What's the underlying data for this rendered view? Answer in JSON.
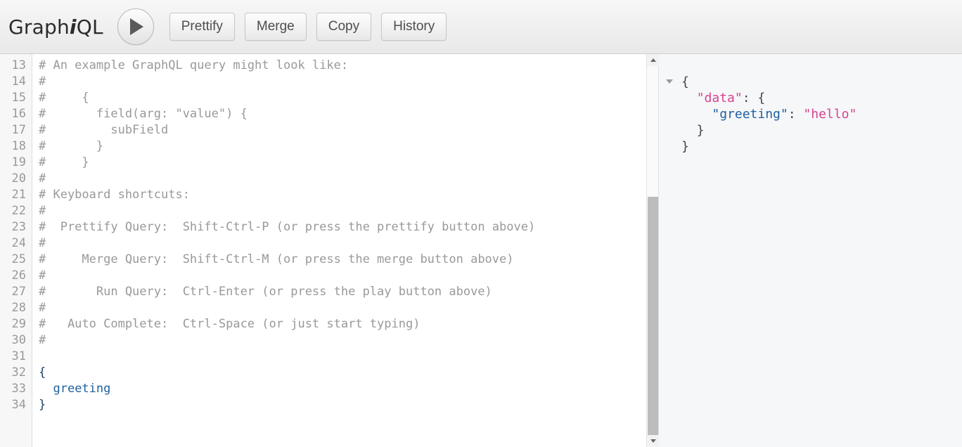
{
  "app": {
    "logo_prefix": "Graph",
    "logo_italic": "i",
    "logo_suffix": "QL"
  },
  "toolbar": {
    "execute_label": "play-icon",
    "prettify_label": "Prettify",
    "merge_label": "Merge",
    "copy_label": "Copy",
    "history_label": "History"
  },
  "editor": {
    "first_line_number": 13,
    "lines": [
      {
        "n": "13",
        "text": "# An example GraphQL query might look like:",
        "kind": "comment"
      },
      {
        "n": "14",
        "text": "#",
        "kind": "comment"
      },
      {
        "n": "15",
        "text": "#     {",
        "kind": "comment"
      },
      {
        "n": "16",
        "text": "#       field(arg: \"value\") {",
        "kind": "comment"
      },
      {
        "n": "17",
        "text": "#         subField",
        "kind": "comment"
      },
      {
        "n": "18",
        "text": "#       }",
        "kind": "comment"
      },
      {
        "n": "19",
        "text": "#     }",
        "kind": "comment"
      },
      {
        "n": "20",
        "text": "#",
        "kind": "comment"
      },
      {
        "n": "21",
        "text": "# Keyboard shortcuts:",
        "kind": "comment"
      },
      {
        "n": "22",
        "text": "#",
        "kind": "comment"
      },
      {
        "n": "23",
        "text": "#  Prettify Query:  Shift-Ctrl-P (or press the prettify button above)",
        "kind": "comment"
      },
      {
        "n": "24",
        "text": "#",
        "kind": "comment"
      },
      {
        "n": "25",
        "text": "#     Merge Query:  Shift-Ctrl-M (or press the merge button above)",
        "kind": "comment"
      },
      {
        "n": "26",
        "text": "#",
        "kind": "comment"
      },
      {
        "n": "27",
        "text": "#       Run Query:  Ctrl-Enter (or press the play button above)",
        "kind": "comment"
      },
      {
        "n": "28",
        "text": "#",
        "kind": "comment"
      },
      {
        "n": "29",
        "text": "#   Auto Complete:  Ctrl-Space (or just start typing)",
        "kind": "comment"
      },
      {
        "n": "30",
        "text": "#",
        "kind": "comment"
      },
      {
        "n": "31",
        "text": "",
        "kind": "blank"
      },
      {
        "n": "32",
        "text": "{",
        "kind": "query"
      },
      {
        "n": "33",
        "text": "  greeting",
        "kind": "field"
      },
      {
        "n": "34",
        "text": "}",
        "kind": "query"
      }
    ]
  },
  "result": {
    "fold_icon": "chevron-down-icon",
    "lines": [
      {
        "parts": [
          {
            "t": "{",
            "c": "plain"
          }
        ]
      },
      {
        "parts": [
          {
            "t": "  ",
            "c": "plain"
          },
          {
            "t": "\"data\"",
            "c": "key-top"
          },
          {
            "t": ": {",
            "c": "plain"
          }
        ]
      },
      {
        "parts": [
          {
            "t": "    ",
            "c": "plain"
          },
          {
            "t": "\"greeting\"",
            "c": "key"
          },
          {
            "t": ": ",
            "c": "plain"
          },
          {
            "t": "\"hello\"",
            "c": "value"
          }
        ]
      },
      {
        "parts": [
          {
            "t": "  }",
            "c": "plain"
          }
        ]
      },
      {
        "parts": [
          {
            "t": "}",
            "c": "plain"
          }
        ]
      }
    ]
  },
  "scrollbar": {
    "up_icon": "triangle-up-icon",
    "down_icon": "triangle-down-icon"
  },
  "colors": {
    "key": "#1f61a0",
    "value": "#d64292",
    "key_top": "#d64292",
    "comment": "#999999",
    "field": "#1f61a0"
  }
}
